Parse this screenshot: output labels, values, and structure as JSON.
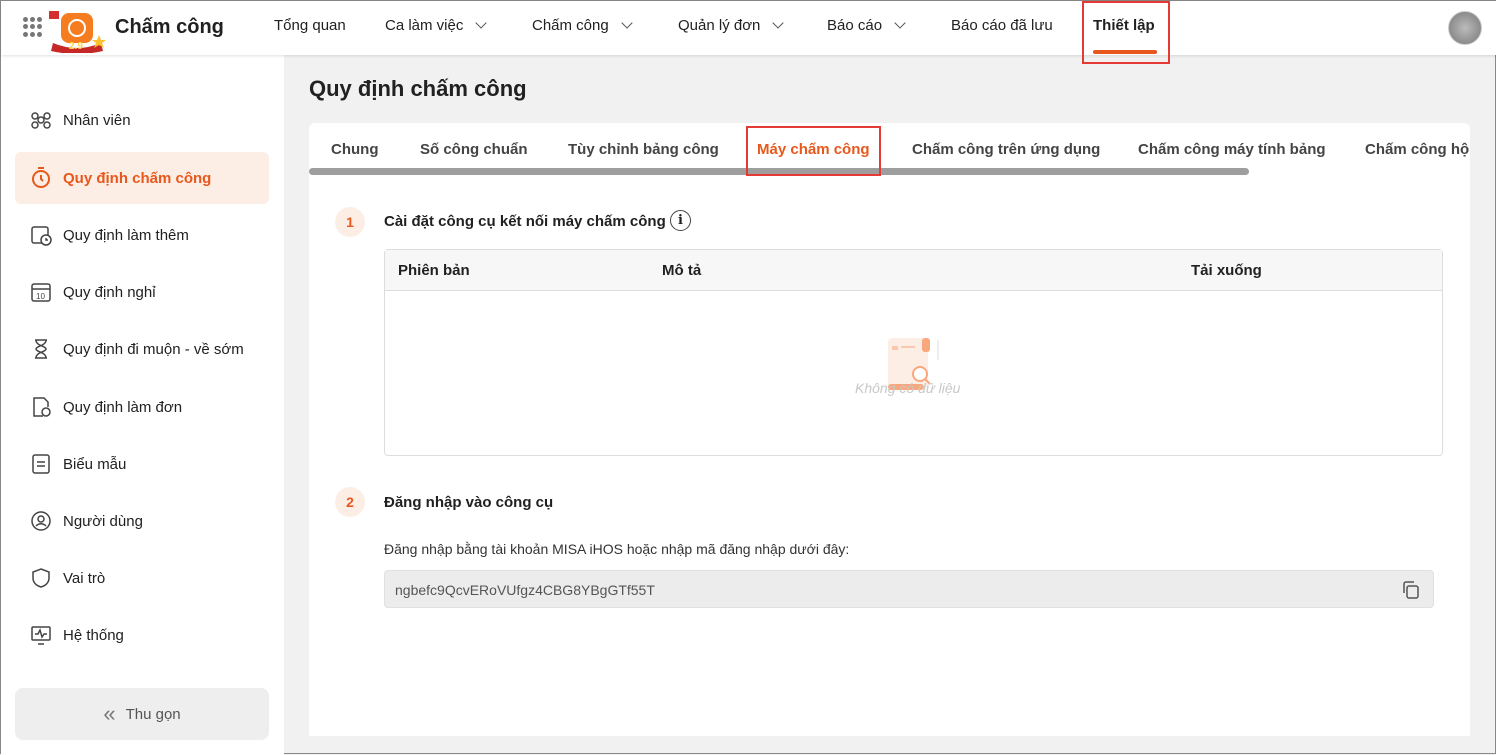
{
  "app": {
    "title": "Chấm công",
    "logo_text": "2.9"
  },
  "topnav": [
    {
      "label": "Tổng quan"
    },
    {
      "label": "Ca làm việc"
    },
    {
      "label": "Chấm công"
    },
    {
      "label": "Quản lý đơn"
    },
    {
      "label": "Báo cáo"
    },
    {
      "label": "Báo cáo đã lưu"
    },
    {
      "label": "Thiết lập"
    }
  ],
  "sidebar": {
    "items": [
      {
        "label": "Nhân viên"
      },
      {
        "label": "Quy định chấm công"
      },
      {
        "label": "Quy định làm thêm"
      },
      {
        "label": "Quy định nghỉ"
      },
      {
        "label": "Quy định đi muộn - về sớm"
      },
      {
        "label": "Quy định làm đơn"
      },
      {
        "label": "Biểu mẫu"
      },
      {
        "label": "Người dùng"
      },
      {
        "label": "Vai trò"
      },
      {
        "label": "Hệ thống"
      }
    ],
    "collapse": "Thu gọn",
    "calendar_num": "10"
  },
  "page": {
    "title": "Quy định chấm công"
  },
  "tabs": [
    {
      "label": "Chung"
    },
    {
      "label": "Số công chuẩn"
    },
    {
      "label": "Tùy chỉnh bảng công"
    },
    {
      "label": "Máy chấm công"
    },
    {
      "label": "Chấm công trên ứng dụng"
    },
    {
      "label": "Chấm công máy tính bảng"
    },
    {
      "label": "Chấm công hộ"
    }
  ],
  "section1": {
    "num": "1",
    "title": "Cài đặt công cụ kết nối máy chấm công",
    "columns": [
      "Phiên bản",
      "Mô tả",
      "Tải xuống"
    ],
    "empty": "Không có dữ liệu"
  },
  "section2": {
    "num": "2",
    "title": "Đăng nhập vào công cụ",
    "desc": "Đăng nhập bằng tài khoản MISA iHOS hoặc nhập mã đăng nhập dưới đây:",
    "code": "ngbefc9QcvERoVUfgz4CBG8YBgGTf55T"
  },
  "colors": {
    "accent": "#e8581c"
  }
}
